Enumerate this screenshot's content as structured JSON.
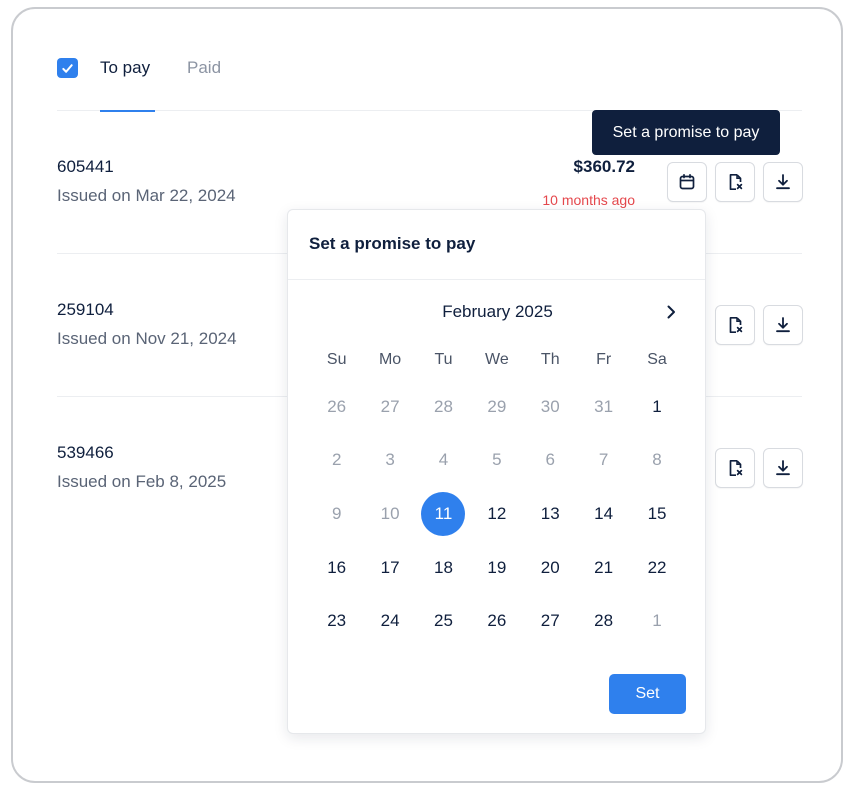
{
  "tabs": {
    "to_pay": "To pay",
    "paid": "Paid"
  },
  "invoices": [
    {
      "number": "605441",
      "issued": "Issued on Mar 22, 2024",
      "amount": "$360.72",
      "relative": "10 months ago"
    },
    {
      "number": "259104",
      "issued": "Issued on Nov 21, 2024"
    },
    {
      "number": "539466",
      "issued": "Issued on Feb 8, 2025"
    }
  ],
  "tooltip": "Set a promise to pay",
  "popover": {
    "title": "Set a promise to pay",
    "month": "February 2025",
    "weekdays": [
      "Su",
      "Mo",
      "Tu",
      "We",
      "Th",
      "Fr",
      "Sa"
    ],
    "weeks": [
      [
        "26",
        "27",
        "28",
        "29",
        "30",
        "31",
        "1"
      ],
      [
        "2",
        "3",
        "4",
        "5",
        "6",
        "7",
        "8"
      ],
      [
        "9",
        "10",
        "11",
        "12",
        "13",
        "14",
        "15"
      ],
      [
        "16",
        "17",
        "18",
        "19",
        "20",
        "21",
        "22"
      ],
      [
        "23",
        "24",
        "25",
        "26",
        "27",
        "28",
        "1"
      ]
    ],
    "selected_day": "11",
    "set_label": "Set"
  },
  "colors": {
    "accent": "#2f80ed",
    "navy": "#0f1f3d",
    "overdue": "#e5484d"
  },
  "icons": [
    "check-icon",
    "calendar-icon",
    "document-x-icon",
    "download-icon",
    "chevron-right-icon"
  ]
}
